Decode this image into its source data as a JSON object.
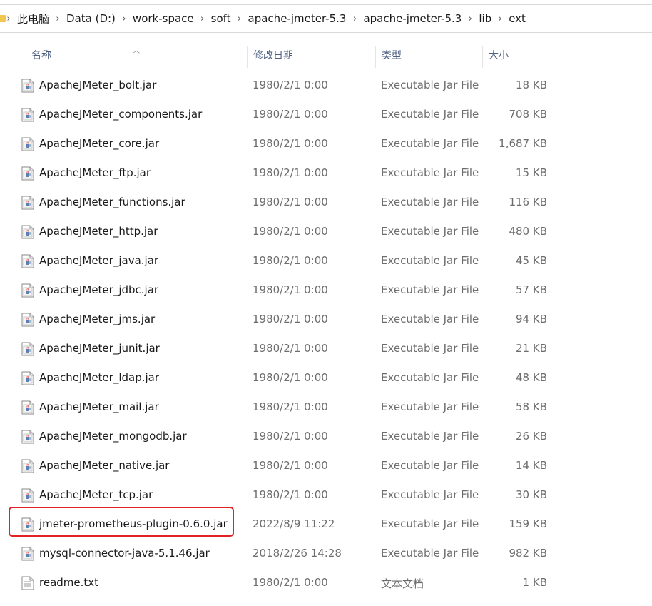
{
  "breadcrumb": [
    "此电脑",
    "Data (D:)",
    "work-space",
    "soft",
    "apache-jmeter-5.3",
    "apache-jmeter-5.3",
    "lib",
    "ext"
  ],
  "columns": {
    "name": "名称",
    "date": "修改日期",
    "type": "类型",
    "size": "大小"
  },
  "files": [
    {
      "name": "ApacheJMeter_bolt.jar",
      "date": "1980/2/1 0:00",
      "type": "Executable Jar File",
      "size": "18 KB",
      "icon": "jar-file-icon"
    },
    {
      "name": "ApacheJMeter_components.jar",
      "date": "1980/2/1 0:00",
      "type": "Executable Jar File",
      "size": "708 KB",
      "icon": "jar-file-icon"
    },
    {
      "name": "ApacheJMeter_core.jar",
      "date": "1980/2/1 0:00",
      "type": "Executable Jar File",
      "size": "1,687 KB",
      "icon": "jar-file-icon"
    },
    {
      "name": "ApacheJMeter_ftp.jar",
      "date": "1980/2/1 0:00",
      "type": "Executable Jar File",
      "size": "15 KB",
      "icon": "jar-file-icon"
    },
    {
      "name": "ApacheJMeter_functions.jar",
      "date": "1980/2/1 0:00",
      "type": "Executable Jar File",
      "size": "116 KB",
      "icon": "jar-file-icon"
    },
    {
      "name": "ApacheJMeter_http.jar",
      "date": "1980/2/1 0:00",
      "type": "Executable Jar File",
      "size": "480 KB",
      "icon": "jar-file-icon"
    },
    {
      "name": "ApacheJMeter_java.jar",
      "date": "1980/2/1 0:00",
      "type": "Executable Jar File",
      "size": "45 KB",
      "icon": "jar-file-icon"
    },
    {
      "name": "ApacheJMeter_jdbc.jar",
      "date": "1980/2/1 0:00",
      "type": "Executable Jar File",
      "size": "57 KB",
      "icon": "jar-file-icon"
    },
    {
      "name": "ApacheJMeter_jms.jar",
      "date": "1980/2/1 0:00",
      "type": "Executable Jar File",
      "size": "94 KB",
      "icon": "jar-file-icon"
    },
    {
      "name": "ApacheJMeter_junit.jar",
      "date": "1980/2/1 0:00",
      "type": "Executable Jar File",
      "size": "21 KB",
      "icon": "jar-file-icon"
    },
    {
      "name": "ApacheJMeter_ldap.jar",
      "date": "1980/2/1 0:00",
      "type": "Executable Jar File",
      "size": "48 KB",
      "icon": "jar-file-icon"
    },
    {
      "name": "ApacheJMeter_mail.jar",
      "date": "1980/2/1 0:00",
      "type": "Executable Jar File",
      "size": "58 KB",
      "icon": "jar-file-icon"
    },
    {
      "name": "ApacheJMeter_mongodb.jar",
      "date": "1980/2/1 0:00",
      "type": "Executable Jar File",
      "size": "26 KB",
      "icon": "jar-file-icon"
    },
    {
      "name": "ApacheJMeter_native.jar",
      "date": "1980/2/1 0:00",
      "type": "Executable Jar File",
      "size": "14 KB",
      "icon": "jar-file-icon"
    },
    {
      "name": "ApacheJMeter_tcp.jar",
      "date": "1980/2/1 0:00",
      "type": "Executable Jar File",
      "size": "30 KB",
      "icon": "jar-file-icon"
    },
    {
      "name": "jmeter-prometheus-plugin-0.6.0.jar",
      "date": "2022/8/9 11:22",
      "type": "Executable Jar File",
      "size": "159 KB",
      "icon": "jar-file-icon",
      "highlighted": true
    },
    {
      "name": "mysql-connector-java-5.1.46.jar",
      "date": "2018/2/26 14:28",
      "type": "Executable Jar File",
      "size": "982 KB",
      "icon": "jar-file-icon"
    },
    {
      "name": "readme.txt",
      "date": "1980/2/1 0:00",
      "type": "文本文档",
      "size": "1 KB",
      "icon": "text-file-icon"
    }
  ],
  "colors": {
    "highlight": "#e02424",
    "header_text": "#4d6082",
    "folder": "#f3c64d"
  }
}
